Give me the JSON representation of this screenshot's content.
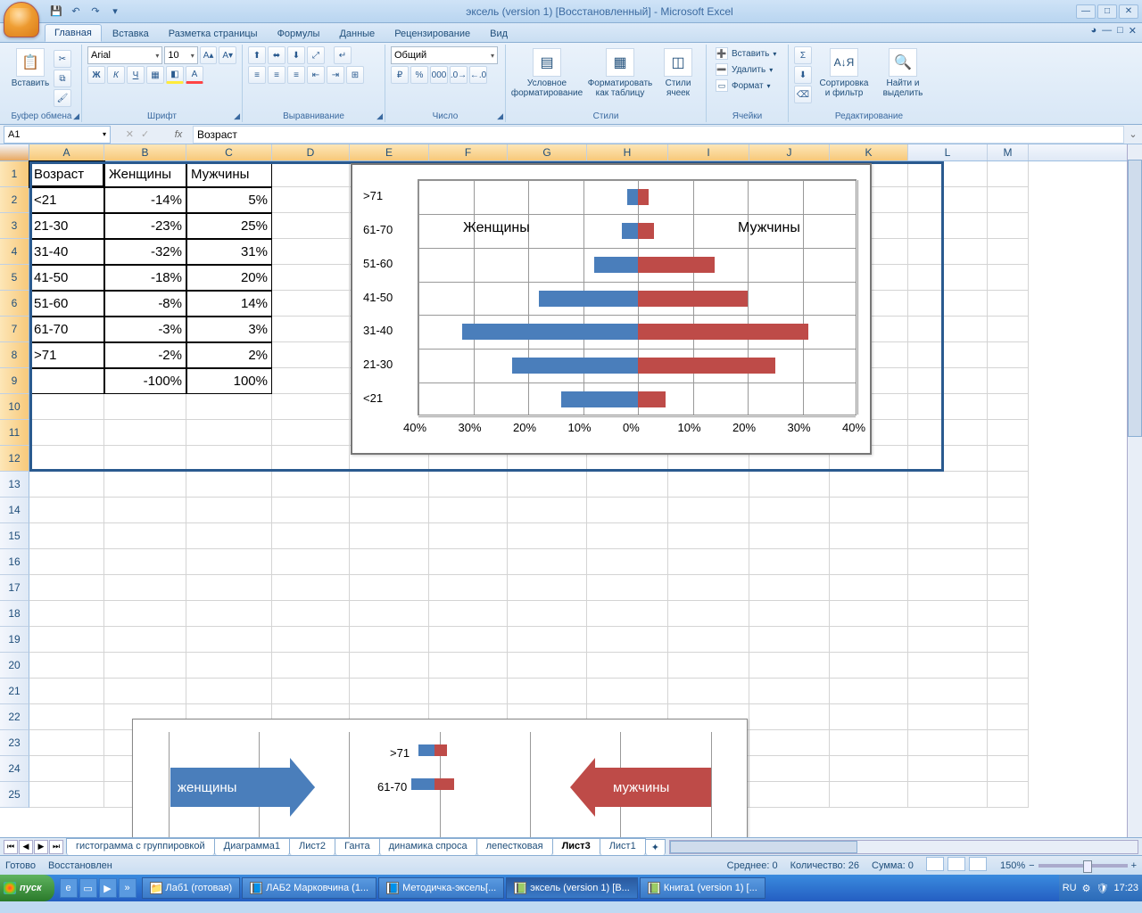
{
  "title": "эксель (version 1) [Восстановленный] - Microsoft Excel",
  "tabs": [
    "Главная",
    "Вставка",
    "Разметка страницы",
    "Формулы",
    "Данные",
    "Рецензирование",
    "Вид"
  ],
  "active_tab": 0,
  "ribbon": {
    "clipboard": {
      "label": "Буфер обмена",
      "paste": "Вставить"
    },
    "font": {
      "label": "Шрифт",
      "name": "Arial",
      "size": "10"
    },
    "align": {
      "label": "Выравнивание"
    },
    "number": {
      "label": "Число",
      "format": "Общий"
    },
    "styles": {
      "label": "Стили",
      "cond": "Условное форматирование",
      "table": "Форматировать как таблицу",
      "cell": "Стили ячеек"
    },
    "cells": {
      "label": "Ячейки",
      "insert": "Вставить",
      "delete": "Удалить",
      "format": "Формат"
    },
    "editing": {
      "label": "Редактирование",
      "sort": "Сортировка и фильтр",
      "find": "Найти и выделить"
    }
  },
  "namebox": "A1",
  "formula": "Возраст",
  "columns": {
    "labels": [
      "A",
      "B",
      "C",
      "D",
      "E",
      "F",
      "G",
      "H",
      "I",
      "J",
      "K",
      "L",
      "M"
    ],
    "widths": [
      84,
      92,
      96,
      87,
      89,
      88,
      89,
      91,
      91,
      90,
      88,
      89,
      46
    ]
  },
  "rows": 25,
  "table": {
    "headers": [
      "Возраст",
      "Женщины",
      "Мужчины"
    ],
    "rows": [
      [
        "<21",
        "-14%",
        "5%"
      ],
      [
        "21-30",
        "-23%",
        "25%"
      ],
      [
        "31-40",
        "-32%",
        "31%"
      ],
      [
        "41-50",
        "-18%",
        "20%"
      ],
      [
        "51-60",
        "-8%",
        "14%"
      ],
      [
        "61-70",
        "-3%",
        "3%"
      ],
      [
        ">71",
        "-2%",
        "2%"
      ]
    ],
    "totals": [
      "",
      "-100%",
      "100%"
    ]
  },
  "chart_data": {
    "type": "bar",
    "orientation": "horizontal",
    "categories": [
      "<21",
      "21-30",
      "31-40",
      "41-50",
      "51-60",
      "61-70",
      ">71"
    ],
    "series": [
      {
        "name": "Женщины",
        "values": [
          -14,
          -23,
          -32,
          -18,
          -8,
          -3,
          -2
        ],
        "color": "#4a7ebb"
      },
      {
        "name": "Мужчины",
        "values": [
          5,
          25,
          31,
          20,
          14,
          3,
          2
        ],
        "color": "#be4b48"
      }
    ],
    "xlabel": "",
    "ylabel": "",
    "xlim": [
      -40,
      40
    ],
    "xticks": [
      "40%",
      "30%",
      "20%",
      "10%",
      "0%",
      "10%",
      "20%",
      "30%",
      "40%"
    ],
    "annotations": [
      "Женщины",
      "Мужчины"
    ]
  },
  "chart2": {
    "categories": [
      ">71",
      "61-70"
    ],
    "arrows": [
      {
        "label": "женщины",
        "color": "blue"
      },
      {
        "label": "мужчины",
        "color": "red"
      }
    ]
  },
  "sheet_tabs": [
    "гистограмма с группировкой",
    "Диаграмма1",
    "Лист2",
    "Ганта",
    "динамика спроса",
    "лепестковая",
    "Лист3",
    "Лист1"
  ],
  "active_sheet": 6,
  "status": {
    "ready": "Готово",
    "restored": "Восстановлен",
    "avg_label": "Среднее:",
    "avg": "0",
    "count_label": "Количество:",
    "count": "26",
    "sum_label": "Сумма:",
    "sum": "0",
    "zoom": "150%"
  },
  "taskbar": {
    "start": "пуск",
    "items": [
      "Лаб1 (готовая)",
      "ЛАБ2 Марковчина (1...",
      "Методичка-эксель[...",
      "эксель (version 1) [В...",
      "Книга1 (version 1) [..."
    ],
    "active": 3,
    "lang": "RU",
    "time": "17:23"
  }
}
